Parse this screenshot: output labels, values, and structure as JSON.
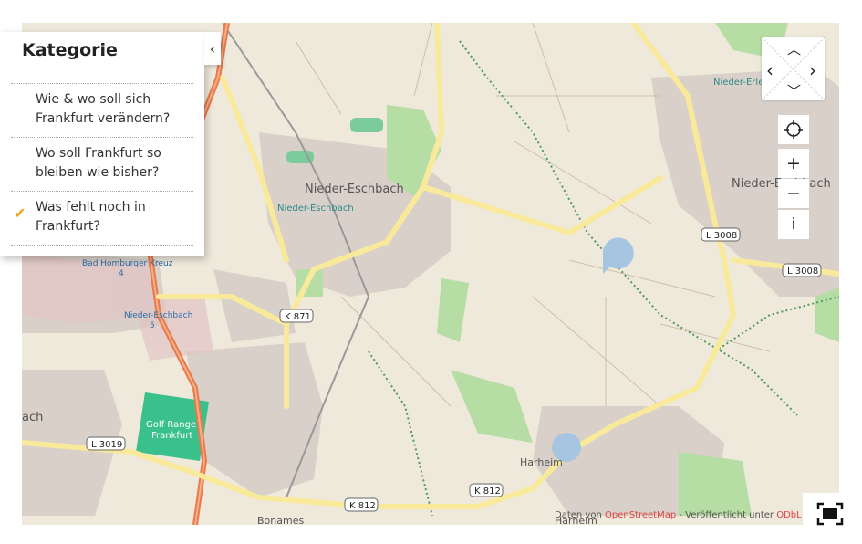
{
  "panel": {
    "title": "Kategorie",
    "collapse_icon": "chevron-left-icon",
    "items": [
      {
        "label_line1": "Wie & wo soll sich",
        "label_line2": "Frankfurt verändern?",
        "selected": false
      },
      {
        "label_line1": "Wo soll Frankfurt so",
        "label_line2": "bleiben wie bisher?",
        "selected": false
      },
      {
        "label_line1": "Was fehlt noch in",
        "label_line2": "Frankfurt?",
        "selected": true
      }
    ]
  },
  "controls": {
    "nav_icons": [
      "chevron-up-icon",
      "chevron-left-icon",
      "chevron-right-icon",
      "chevron-down-icon"
    ],
    "locate_icon": "crosshair-icon",
    "zoom_in": "+",
    "zoom_out": "−",
    "info": "i",
    "fullscreen_icon": "fullscreen-icon"
  },
  "map_labels": {
    "place_1": "Nieder-Eschbach",
    "place_2": "Nieder-Eschbach",
    "place_3": "Nieder-Eschbach",
    "place_partial_top_right": "Nieder-Erle",
    "place_partial_left": "ach",
    "harheim": "Harheim",
    "harheim_bottom": "Harheim",
    "bonames": "Bonames",
    "kreuz": "Bad Homburger Kreuz",
    "kreuz_num": "4",
    "exit_label": "Nieder-Eschbach",
    "exit_num": "5",
    "golf_line1": "Golf Range",
    "golf_line2": "Frankfurt"
  },
  "road_shields": [
    "K 871",
    "L 3008",
    "L 3008",
    "L 3019",
    "K 812",
    "K 812"
  ],
  "attribution": {
    "prefix": "Daten von",
    "osm": "OpenStreetMap",
    "middle": "- Veröffentlicht unter",
    "license": "ODbL"
  },
  "colors": {
    "map_bg": "#efe9dc",
    "major_road": "#f8ea9a",
    "motorway": "#e97a4b",
    "residential": "#d9d0c9",
    "green": "#b6dda4",
    "water": "#aad3df",
    "accent_check": "#f0a020",
    "marker": "#a6c5e0"
  }
}
